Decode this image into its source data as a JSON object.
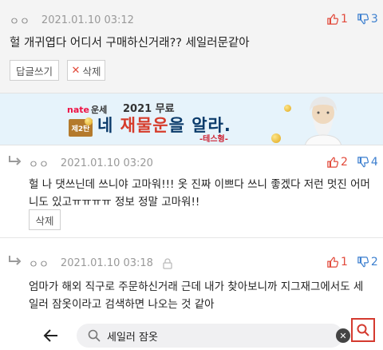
{
  "comment1": {
    "author": "ㅇㅇ",
    "date": "2021.01.10 03:12",
    "upvotes": "1",
    "downvotes": "3",
    "text": "헐 개귀엽다 어디서 구매하신거래?? 세일러문같아",
    "reply_button": "답글쓰기",
    "delete_button": "삭제"
  },
  "banner": {
    "brand": "nate",
    "service": "운세",
    "edition": "제2탄",
    "top_text": "2021 무료",
    "main_prefix": "네 ",
    "main_highlight": "재물운",
    "main_suffix": "을 알라.",
    "sub_text": "-테스형-"
  },
  "comment2": {
    "author": "ㅇㅇ",
    "date": "2021.01.10 03:20",
    "upvotes": "2",
    "downvotes": "4",
    "text_line1": "헐 나 댓쓰닌데 쓰니야 고마워!!! 옷 진짜 이쁘다 쓰니 좋겠다 저런 멋진 어머",
    "text_line2": "니도 있고ㅠㅠㅠㅠ 정보 정말 고마워!!",
    "delete_button": "삭제"
  },
  "comment3": {
    "author": "ㅇㅇ",
    "date": "2021.01.10 03:18",
    "upvotes": "1",
    "downvotes": "2",
    "text_line1": "엄마가 해외 직구로 주문하신거래 근데 내가 찾아보니까 지그재그에서도 세",
    "text_line2": "일러 잠옷이라고 검색하면 나오는 것 같아"
  },
  "search": {
    "query": "세일러 잠옷",
    "clear_label": "✕"
  },
  "colors": {
    "upvote": "#e24a3b",
    "downvote": "#3c7fcf",
    "search_accent": "#d43a2f"
  }
}
